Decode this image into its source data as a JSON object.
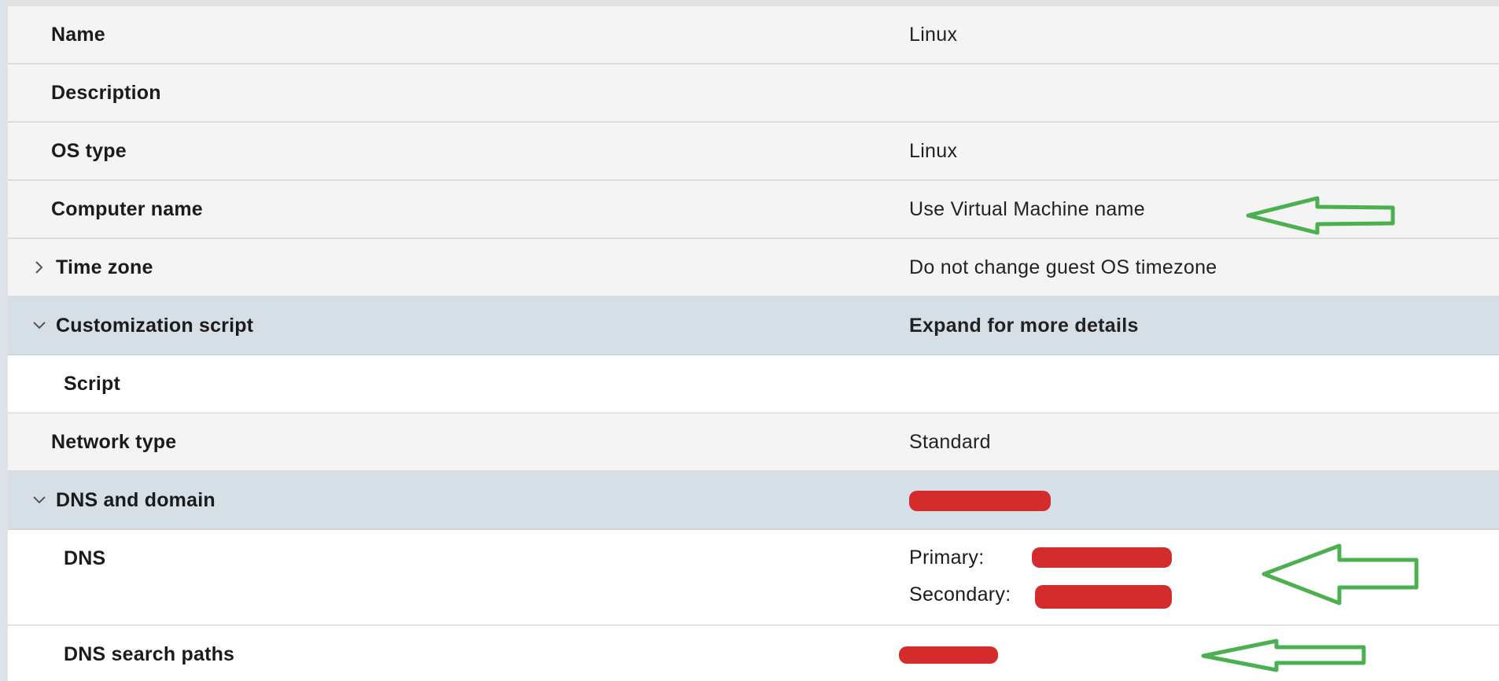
{
  "rows": {
    "name": {
      "label": "Name",
      "value": "Linux"
    },
    "description": {
      "label": "Description",
      "value": ""
    },
    "os_type": {
      "label": "OS type",
      "value": "Linux"
    },
    "computer_name": {
      "label": "Computer name",
      "value": "Use Virtual Machine name"
    },
    "time_zone": {
      "label": "Time zone",
      "value": "Do not change guest OS timezone",
      "expanded": false
    },
    "customization_script": {
      "label": "Customization script",
      "value": "Expand for more details",
      "expanded": true
    },
    "script": {
      "label": "Script",
      "value": ""
    },
    "network_type": {
      "label": "Network type",
      "value": "Standard"
    },
    "dns_and_domain": {
      "label": "DNS and domain",
      "value": "",
      "expanded": true
    },
    "dns": {
      "label": "DNS",
      "primary_label": "Primary:",
      "secondary_label": "Secondary:"
    },
    "dns_search_paths": {
      "label": "DNS search paths"
    }
  },
  "annotations": {
    "arrow_color": "#4caf50",
    "redaction_color": "#d42c2c"
  }
}
